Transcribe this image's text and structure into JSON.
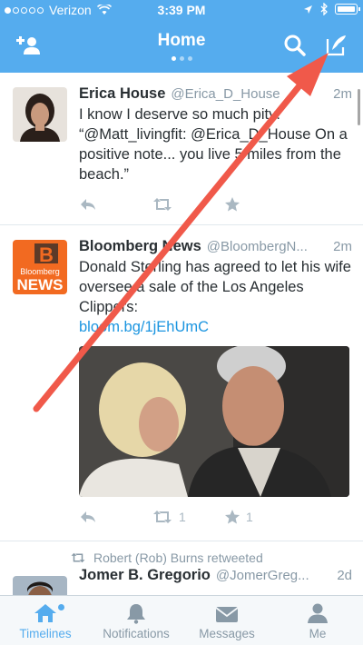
{
  "status_bar": {
    "carrier": "Verizon",
    "time": "3:39 PM"
  },
  "nav": {
    "title": "Home",
    "left_icon": "add-user-icon",
    "right_icons": [
      "search-icon",
      "compose-icon"
    ]
  },
  "tweets": [
    {
      "name": "Erica House",
      "handle": "@Erica_D_House",
      "time": "2m",
      "text": "I know I deserve so much pity! “@Matt_livingfit: @Erica_D_House On a positive note... you live 5 miles from the beach.”",
      "retweet_count": "",
      "favorite_count": ""
    },
    {
      "name": "Bloomberg News",
      "handle": "@BloombergN...",
      "time": "2m",
      "text": "Donald Sterling has agreed to let his wife oversee a sale of the Los Angeles Clippers:",
      "link": "bloom.bg/1jEhUmC",
      "avatar_text": "Bloomberg",
      "avatar_big": "NEWS",
      "retweet_count": "1",
      "favorite_count": "1"
    },
    {
      "retweeted_by": "Robert (Rob) Burns retweeted",
      "name": "Jomer B. Gregorio",
      "handle": "@JomerGreg...",
      "time": "2d"
    }
  ],
  "tabs": [
    {
      "label": "Timelines",
      "icon": "home-icon"
    },
    {
      "label": "Notifications",
      "icon": "bell-icon"
    },
    {
      "label": "Messages",
      "icon": "envelope-icon"
    },
    {
      "label": "Me",
      "icon": "person-icon"
    }
  ],
  "colors": {
    "brand": "#55acee",
    "annotation_arrow": "#f0594a",
    "link": "#1b95e0"
  }
}
